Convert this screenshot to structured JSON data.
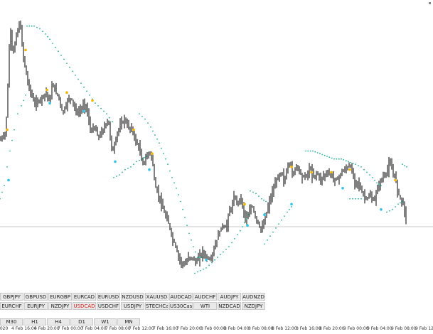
{
  "chart_data": {
    "type": "candlestick",
    "indicator": "Parabolic SAR",
    "colors": {
      "background": "#ffffff",
      "candles": "#000000",
      "sar_dots": "#1fb59a",
      "fractal_up": "#f2b400",
      "fractal_down": "#2ec3e6",
      "hline": "#c8c8c8"
    },
    "hline_level": 0.8,
    "ylim": [
      0,
      1
    ],
    "price_path": [
      [
        0,
        0.52
      ],
      [
        8,
        0.55
      ],
      [
        12,
        0.78
      ],
      [
        14,
        0.96
      ],
      [
        18,
        0.84
      ],
      [
        22,
        0.9
      ],
      [
        28,
        0.97
      ],
      [
        32,
        0.85
      ],
      [
        38,
        0.75
      ],
      [
        42,
        0.71
      ],
      [
        48,
        0.66
      ],
      [
        52,
        0.66
      ],
      [
        58,
        0.68
      ],
      [
        65,
        0.7
      ],
      [
        70,
        0.66
      ],
      [
        74,
        0.74
      ],
      [
        78,
        0.7
      ],
      [
        82,
        0.69
      ],
      [
        88,
        0.62
      ],
      [
        95,
        0.67
      ],
      [
        100,
        0.68
      ],
      [
        108,
        0.62
      ],
      [
        115,
        0.64
      ],
      [
        120,
        0.66
      ],
      [
        128,
        0.55
      ],
      [
        133,
        0.57
      ],
      [
        138,
        0.53
      ],
      [
        145,
        0.56
      ],
      [
        152,
        0.6
      ],
      [
        158,
        0.47
      ],
      [
        165,
        0.55
      ],
      [
        170,
        0.58
      ],
      [
        175,
        0.6
      ],
      [
        180,
        0.57
      ],
      [
        186,
        0.56
      ],
      [
        190,
        0.52
      ],
      [
        196,
        0.49
      ],
      [
        200,
        0.43
      ],
      [
        205,
        0.45
      ],
      [
        210,
        0.48
      ],
      [
        214,
        0.45
      ],
      [
        218,
        0.35
      ],
      [
        222,
        0.32
      ],
      [
        228,
        0.27
      ],
      [
        232,
        0.24
      ],
      [
        238,
        0.2
      ],
      [
        242,
        0.15
      ],
      [
        246,
        0.13
      ],
      [
        250,
        0.09
      ],
      [
        255,
        0.06
      ],
      [
        260,
        0.05
      ],
      [
        265,
        0.08
      ],
      [
        270,
        0.08
      ],
      [
        275,
        0.06
      ],
      [
        280,
        0.08
      ],
      [
        285,
        0.1
      ],
      [
        290,
        0.08
      ],
      [
        296,
        0.07
      ],
      [
        302,
        0.12
      ],
      [
        308,
        0.17
      ],
      [
        312,
        0.2
      ],
      [
        318,
        0.19
      ],
      [
        322,
        0.25
      ],
      [
        326,
        0.27
      ],
      [
        330,
        0.31
      ],
      [
        334,
        0.28
      ],
      [
        338,
        0.31
      ],
      [
        342,
        0.26
      ],
      [
        346,
        0.22
      ],
      [
        350,
        0.24
      ],
      [
        354,
        0.28
      ],
      [
        358,
        0.24
      ],
      [
        364,
        0.2
      ],
      [
        368,
        0.18
      ],
      [
        372,
        0.22
      ],
      [
        376,
        0.26
      ],
      [
        380,
        0.3
      ],
      [
        384,
        0.33
      ],
      [
        390,
        0.38
      ],
      [
        396,
        0.4
      ],
      [
        400,
        0.36
      ],
      [
        404,
        0.42
      ],
      [
        408,
        0.44
      ],
      [
        412,
        0.38
      ],
      [
        416,
        0.43
      ],
      [
        420,
        0.41
      ],
      [
        426,
        0.38
      ],
      [
        432,
        0.39
      ],
      [
        436,
        0.42
      ],
      [
        440,
        0.38
      ],
      [
        446,
        0.4
      ],
      [
        450,
        0.37
      ],
      [
        456,
        0.39
      ],
      [
        462,
        0.4
      ],
      [
        468,
        0.38
      ],
      [
        474,
        0.37
      ],
      [
        480,
        0.4
      ],
      [
        486,
        0.41
      ],
      [
        492,
        0.43
      ],
      [
        498,
        0.37
      ],
      [
        504,
        0.36
      ],
      [
        508,
        0.33
      ],
      [
        514,
        0.3
      ],
      [
        520,
        0.31
      ],
      [
        526,
        0.29
      ],
      [
        532,
        0.35
      ],
      [
        538,
        0.38
      ],
      [
        544,
        0.4
      ],
      [
        548,
        0.44
      ],
      [
        552,
        0.4
      ],
      [
        556,
        0.38
      ],
      [
        560,
        0.32
      ],
      [
        566,
        0.29
      ],
      [
        572,
        0.22
      ]
    ],
    "sar_segments": [
      [
        [
          0,
          0.3
        ],
        [
          6,
          0.35
        ],
        [
          10,
          0.42
        ],
        [
          14,
          0.48
        ],
        [
          20,
          0.56
        ],
        [
          25,
          0.62
        ],
        [
          30,
          0.65
        ],
        [
          33,
          0.67
        ],
        [
          36,
          0.69
        ]
      ],
      [
        [
          38,
          0.95
        ],
        [
          48,
          0.95
        ],
        [
          56,
          0.94
        ],
        [
          64,
          0.92
        ],
        [
          70,
          0.9
        ],
        [
          78,
          0.87
        ],
        [
          86,
          0.84
        ],
        [
          94,
          0.81
        ],
        [
          102,
          0.78
        ],
        [
          110,
          0.75
        ],
        [
          118,
          0.72
        ],
        [
          126,
          0.69
        ],
        [
          134,
          0.66
        ],
        [
          142,
          0.64
        ],
        [
          150,
          0.62
        ],
        [
          158,
          0.59
        ]
      ],
      [
        [
          160,
          0.38
        ],
        [
          168,
          0.39
        ],
        [
          176,
          0.41
        ],
        [
          184,
          0.42
        ],
        [
          192,
          0.44
        ],
        [
          200,
          0.45
        ],
        [
          206,
          0.46
        ]
      ],
      [
        [
          196,
          0.62
        ],
        [
          204,
          0.6
        ],
        [
          212,
          0.57
        ],
        [
          218,
          0.54
        ],
        [
          224,
          0.51
        ],
        [
          230,
          0.47
        ],
        [
          236,
          0.43
        ],
        [
          242,
          0.38
        ],
        [
          248,
          0.34
        ],
        [
          254,
          0.29
        ],
        [
          260,
          0.23
        ],
        [
          266,
          0.17
        ],
        [
          272,
          0.12
        ],
        [
          278,
          0.08
        ],
        [
          284,
          0.08
        ]
      ],
      [
        [
          274,
          0.02
        ],
        [
          282,
          0.03
        ],
        [
          290,
          0.04
        ],
        [
          298,
          0.06
        ],
        [
          306,
          0.08
        ],
        [
          314,
          0.1
        ],
        [
          322,
          0.12
        ],
        [
          330,
          0.15
        ],
        [
          338,
          0.18
        ],
        [
          344,
          0.21
        ],
        [
          350,
          0.24
        ]
      ],
      [
        [
          352,
          0.33
        ],
        [
          360,
          0.32
        ],
        [
          368,
          0.3
        ],
        [
          374,
          0.29
        ]
      ],
      [
        [
          372,
          0.13
        ],
        [
          380,
          0.16
        ],
        [
          388,
          0.19
        ],
        [
          396,
          0.22
        ],
        [
          404,
          0.25
        ],
        [
          410,
          0.27
        ]
      ],
      [
        [
          430,
          0.48
        ],
        [
          440,
          0.48
        ],
        [
          450,
          0.47
        ],
        [
          460,
          0.46
        ],
        [
          470,
          0.45
        ],
        [
          480,
          0.45
        ],
        [
          490,
          0.44
        ],
        [
          500,
          0.43
        ],
        [
          508,
          0.42
        ],
        [
          516,
          0.4
        ],
        [
          524,
          0.38
        ],
        [
          530,
          0.36
        ],
        [
          536,
          0.35
        ]
      ],
      [
        [
          492,
          0.3
        ],
        [
          500,
          0.3
        ],
        [
          508,
          0.3
        ]
      ],
      [
        [
          544,
          0.25
        ],
        [
          552,
          0.26
        ],
        [
          560,
          0.28
        ],
        [
          566,
          0.29
        ]
      ],
      [
        [
          566,
          0.43
        ],
        [
          572,
          0.42
        ]
      ]
    ],
    "fractals_up": [
      [
        10,
        0.56
      ],
      [
        36,
        0.86
      ],
      [
        66,
        0.71
      ],
      [
        94,
        0.7
      ],
      [
        130,
        0.67
      ],
      [
        188,
        0.56
      ],
      [
        214,
        0.47
      ],
      [
        344,
        0.28
      ],
      [
        410,
        0.42
      ],
      [
        438,
        0.4
      ],
      [
        466,
        0.4
      ],
      [
        492,
        0.41
      ],
      [
        556,
        0.37
      ]
    ],
    "fractals_down": [
      [
        12,
        0.37
      ],
      [
        70,
        0.66
      ],
      [
        118,
        0.63
      ],
      [
        162,
        0.44
      ],
      [
        210,
        0.41
      ],
      [
        290,
        0.07
      ],
      [
        348,
        0.2
      ],
      [
        372,
        0.24
      ],
      [
        410,
        0.28
      ],
      [
        482,
        0.34
      ],
      [
        536,
        0.26
      ]
    ]
  },
  "symbol_bar": {
    "row1": [
      {
        "label": "GBPJPY",
        "active": false
      },
      {
        "label": "GBPUSD",
        "active": false
      },
      {
        "label": "EURGBP",
        "active": false
      },
      {
        "label": "EURCAD",
        "active": false
      },
      {
        "label": "EURUSD",
        "active": false
      },
      {
        "label": "NZDUSD",
        "active": false
      },
      {
        "label": "XAUUSD",
        "active": false
      },
      {
        "label": "AUDCAD",
        "active": false
      },
      {
        "label": "AUDCHF",
        "active": false
      },
      {
        "label": "AUDJPY",
        "active": false
      },
      {
        "label": "AUDNZD",
        "active": false
      }
    ],
    "row2": [
      {
        "label": "EURCHF",
        "active": false
      },
      {
        "label": "EURJPY",
        "active": false
      },
      {
        "label": "NZDJPY",
        "active": false
      },
      {
        "label": "USDCAD",
        "active": true
      },
      {
        "label": "USDCHF",
        "active": false
      },
      {
        "label": "USDJPY",
        "active": false
      },
      {
        "label": "STECHCash",
        "active": false
      },
      {
        "label": "US30Cash",
        "active": false
      },
      {
        "label": "WTI",
        "active": false
      },
      {
        "label": "NZDCAD",
        "active": false
      },
      {
        "label": "NZDJPY",
        "active": false
      }
    ]
  },
  "timeframes": [
    "M30",
    "H1",
    "H4",
    "D1",
    "W1",
    "MN"
  ],
  "time_axis": {
    "labels": [
      "2020",
      "4 Feb 16:00",
      "4 Feb 20:00",
      "7 Feb 00:00",
      "7 Feb 04:00",
      "7 Feb 08:00",
      "7 Feb 12:00",
      "7 Feb 16:00",
      "7 Feb 20:00",
      "8 Feb 00:00",
      "8 Feb 04:00",
      "8 Feb 08:00",
      "8 Feb 12:00",
      "8 Feb 16:00",
      "8 Feb 20:00",
      "9 Feb 00:00",
      "9 Feb 04:00",
      "9 Feb 08:00",
      "9 Feb 12:00"
    ]
  }
}
